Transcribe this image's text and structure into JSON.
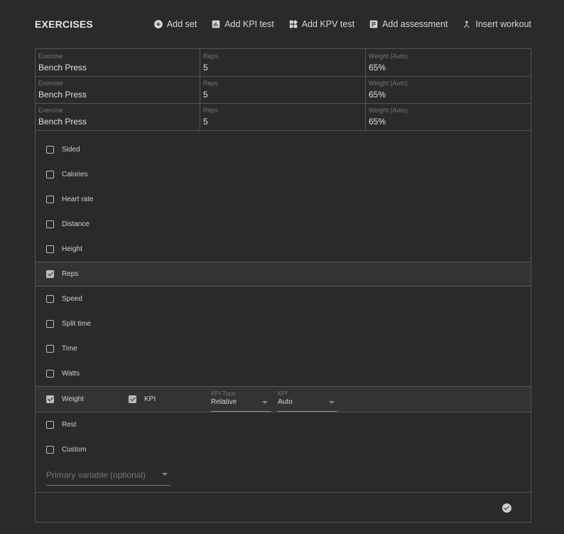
{
  "header": {
    "title": "EXERCISES",
    "actions": [
      {
        "label": "Add set",
        "icon": "add-circle-icon"
      },
      {
        "label": "Add KPI test",
        "icon": "bar-chart-icon"
      },
      {
        "label": "Add KPV test",
        "icon": "widgets-icon"
      },
      {
        "label": "Add assessment",
        "icon": "assessment-icon"
      },
      {
        "label": "Insert workout",
        "icon": "merge-icon"
      }
    ]
  },
  "sets": {
    "columns": [
      "Exercise",
      "Reps",
      "Weight (Auto)"
    ],
    "rows": [
      [
        "Bench Press",
        "5",
        "65%"
      ],
      [
        "Bench Press",
        "5",
        "65%"
      ],
      [
        "Bench Press",
        "5",
        "65%"
      ]
    ]
  },
  "variables": [
    {
      "label": "Sided",
      "checked": false
    },
    {
      "label": "Calories",
      "checked": false
    },
    {
      "label": "Heart rate",
      "checked": false
    },
    {
      "label": "Distance",
      "checked": false
    },
    {
      "label": "Height",
      "checked": false
    },
    {
      "label": "Reps",
      "checked": true
    },
    {
      "label": "Speed",
      "checked": false
    },
    {
      "label": "Split time",
      "checked": false
    },
    {
      "label": "Time",
      "checked": false
    },
    {
      "label": "Watts",
      "checked": false
    },
    {
      "label": "Weight",
      "checked": true
    },
    {
      "label": "Rest",
      "checked": false
    },
    {
      "label": "Custom",
      "checked": false
    }
  ],
  "weight_options": {
    "kpi_label": "KPI",
    "kpi_checked": true,
    "kpi_type_label": "KPI Type",
    "kpi_type_value": "Relative",
    "kpi_label2": "KPI",
    "kpi_value": "Auto"
  },
  "primary_variable": {
    "placeholder": "Primary variable (optional)"
  },
  "colors": {
    "background": "#2a2a2a",
    "border": "#555555",
    "selected_row": "#333333",
    "text": "#e0e0e0"
  }
}
